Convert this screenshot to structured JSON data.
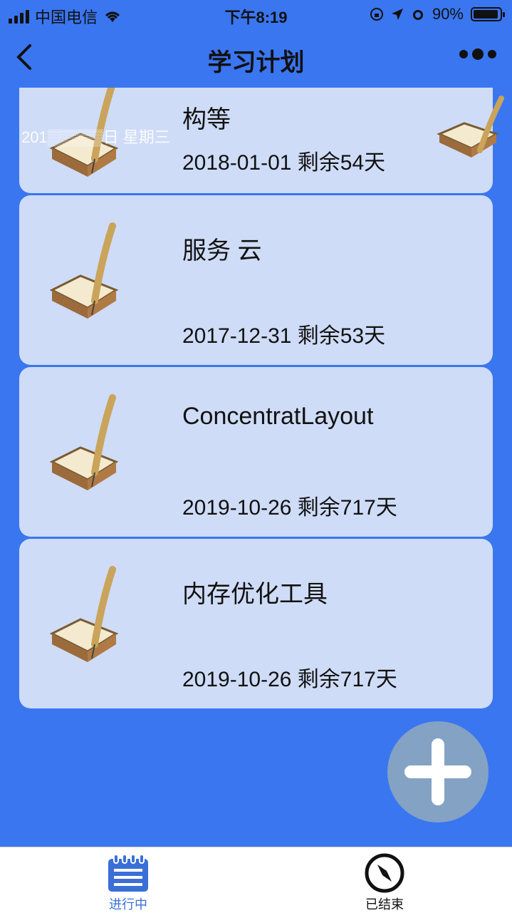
{
  "status_bar": {
    "carrier": "中国电信",
    "time": "下午8:19",
    "battery": "90%"
  },
  "nav": {
    "title": "学习计划"
  },
  "header_overlay": {
    "text": "201▒▒▒▒▒日  星期三"
  },
  "plans": [
    {
      "name": "构等",
      "date": "2018-01-01 剩余54天"
    },
    {
      "name": "服务 云",
      "date": "2017-12-31 剩余53天"
    },
    {
      "name": "ConcentratLayout",
      "date": "2019-10-26 剩余717天"
    },
    {
      "name": "内存优化工具",
      "date": "2019-10-26 剩余717天"
    }
  ],
  "tabs": {
    "active_label": "进行中",
    "done_label": "已结束"
  },
  "colors": {
    "background": "#3a76f0",
    "card": "#cfdcf7",
    "fab": "#84a2c4",
    "tab_active": "#3a6fd8"
  },
  "icons": [
    "back-chevron-icon",
    "more-dots-icon",
    "book-quill-icon",
    "plus-icon",
    "list-icon",
    "compass-icon"
  ]
}
